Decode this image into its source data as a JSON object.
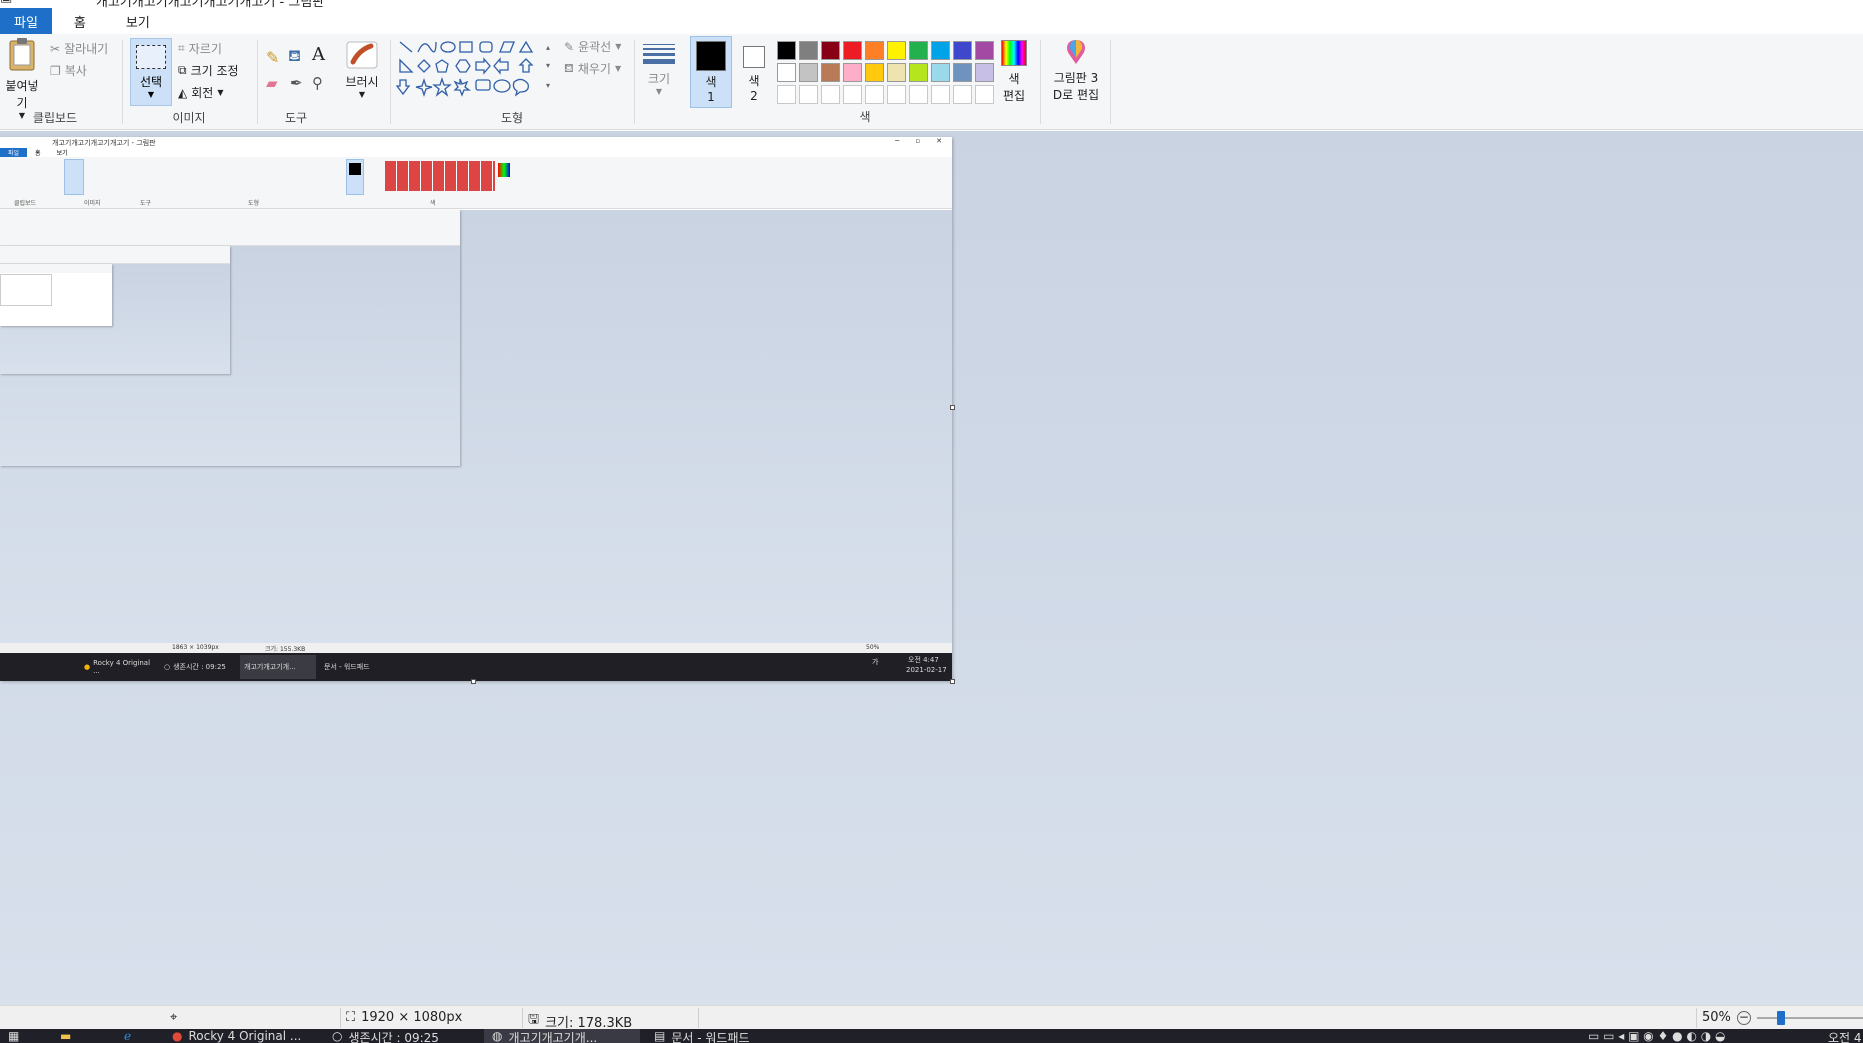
{
  "window": {
    "title": "개고기개고기개고기개고기개고기 - 그림판",
    "minimize_glyph": "─"
  },
  "menu": {
    "file": "파일",
    "home": "홈",
    "view": "보기"
  },
  "ribbon": {
    "clipboard": {
      "paste": "붙여넣기",
      "cut": "잘라내기",
      "copy": "복사",
      "group": "클립보드"
    },
    "image": {
      "select": "선택",
      "crop": "자르기",
      "resize": "크기 조정",
      "rotate": "회전",
      "group": "이미지"
    },
    "tools": {
      "group": "도구",
      "text_glyph": "A"
    },
    "brushes": {
      "label": "브러시"
    },
    "shapes": {
      "outline": "윤곽선",
      "fill": "채우기",
      "group": "도형"
    },
    "size": {
      "label": "크기"
    },
    "colors": {
      "color1_line1": "색",
      "color1_line2": "1",
      "color2_line1": "색",
      "color2_line2": "2",
      "edit_line1": "색",
      "edit_line2": "편집",
      "group": "색",
      "color1": "#000000",
      "color2": "#ffffff",
      "palette": [
        "#000000",
        "#7f7f7f",
        "#880015",
        "#ed1c24",
        "#ff7f27",
        "#fff200",
        "#22b14c",
        "#00a2e8",
        "#3f48cc",
        "#a349a4",
        "#ffffff",
        "#c3c3c3",
        "#b97a57",
        "#ffaec9",
        "#ffc90e",
        "#efe4b0",
        "#b5e61d",
        "#99d9ea",
        "#7092be",
        "#c8bfe7"
      ]
    },
    "paint3d": {
      "line1": "그림판 3",
      "line2": "D로 편집"
    }
  },
  "nested": {
    "title": "개고기개고기개고기개고기 - 그림판",
    "tabs": [
      "파일",
      "홈",
      "보기"
    ],
    "groups": [
      "클립보드",
      "이미지",
      "도구",
      "도형",
      "색"
    ],
    "status_dims": "1863 × 1039px",
    "status_size": "크기: 155.3KB",
    "zoom": "50%",
    "taskbar": {
      "chrome": "Rocky 4 Original ...",
      "timer": "생존시간 : 09:25",
      "paint": "개고기개고기개...",
      "wordpad": "문서 - 워드패드",
      "time": "오전 4:47",
      "date": "2021-02-17",
      "lang": "가"
    }
  },
  "status": {
    "dimensions": "1920 × 1080px",
    "size": "크기: 178.3KB",
    "zoom": "50%"
  },
  "taskbar": {
    "chrome": "Rocky 4 Original ...",
    "timer": "생존시간 : 09:25",
    "paint": "개고기개고기개...",
    "wordpad": "문서 - 워드패드",
    "time": "오전 4"
  }
}
